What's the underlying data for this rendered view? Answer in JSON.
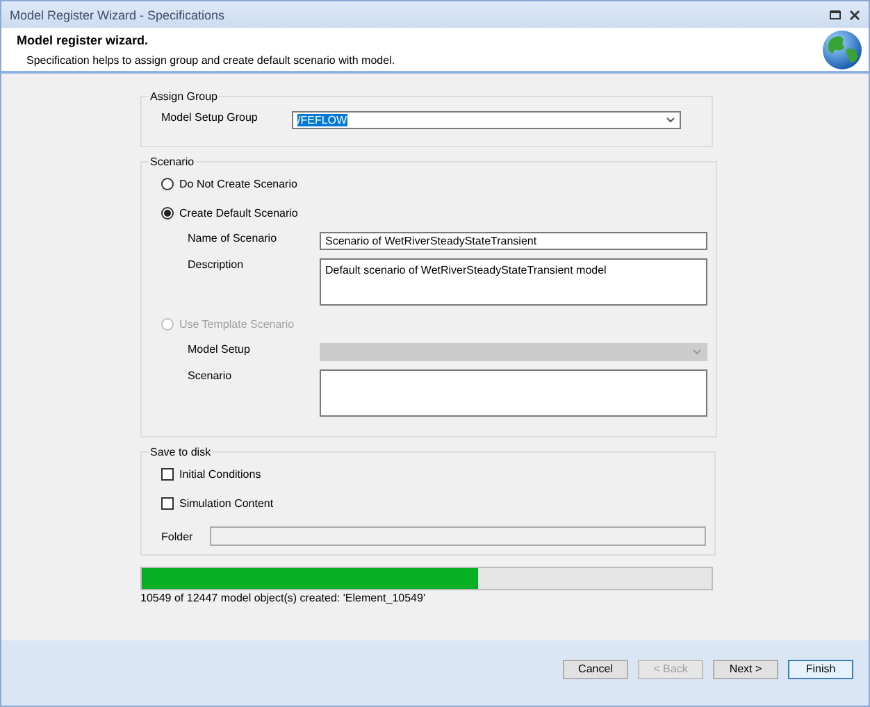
{
  "window": {
    "title": "Model Register Wizard - Specifications"
  },
  "header": {
    "title": "Model register wizard.",
    "subtitle": "Specification helps to assign group and create default scenario with model."
  },
  "assign_group": {
    "title": "Assign Group",
    "fields": [
      {
        "label": "Model Setup Group",
        "kind": "dropdown",
        "value": "/FEFLOW",
        "text_selected": true,
        "disabled": false
      }
    ]
  },
  "scenario": {
    "title": "Scenario",
    "options": [
      {
        "label": "Do Not Create Scenario",
        "selected": false,
        "disabled": false
      },
      {
        "label": "Create Default Scenario",
        "selected": true,
        "disabled": false,
        "fields": [
          {
            "label": "Name of Scenario",
            "kind": "text",
            "value": "Scenario of WetRiverSteadyStateTransient",
            "disabled": false
          },
          {
            "label": "Description",
            "kind": "textarea",
            "value": "Default scenario of WetRiverSteadyStateTransient model",
            "disabled": false
          }
        ]
      },
      {
        "label": "Use Template Scenario",
        "selected": false,
        "disabled": true,
        "fields": [
          {
            "label": "Model Setup",
            "kind": "dropdown",
            "disabled": true
          },
          {
            "label": "Scenario",
            "kind": "textarea",
            "disabled": false
          }
        ]
      }
    ]
  },
  "save_to_disk": {
    "title": "Save to disk",
    "checkboxes": [
      {
        "label": "Initial Conditions",
        "checked": false
      },
      {
        "label": "Simulation Content",
        "checked": false
      }
    ],
    "folder": {
      "label": "Folder",
      "disabled": true
    }
  },
  "progress": {
    "level": 0.59,
    "status": "10549 of 12447 model object(s) created: 'Element_10549'"
  },
  "buttons": [
    {
      "label": "Cancel",
      "disabled": false,
      "default": false
    },
    {
      "label": "< Back",
      "disabled": true,
      "default": false
    },
    {
      "label": "Next >",
      "disabled": false,
      "default": false
    },
    {
      "label": "Finish",
      "disabled": false,
      "default": true
    }
  ]
}
